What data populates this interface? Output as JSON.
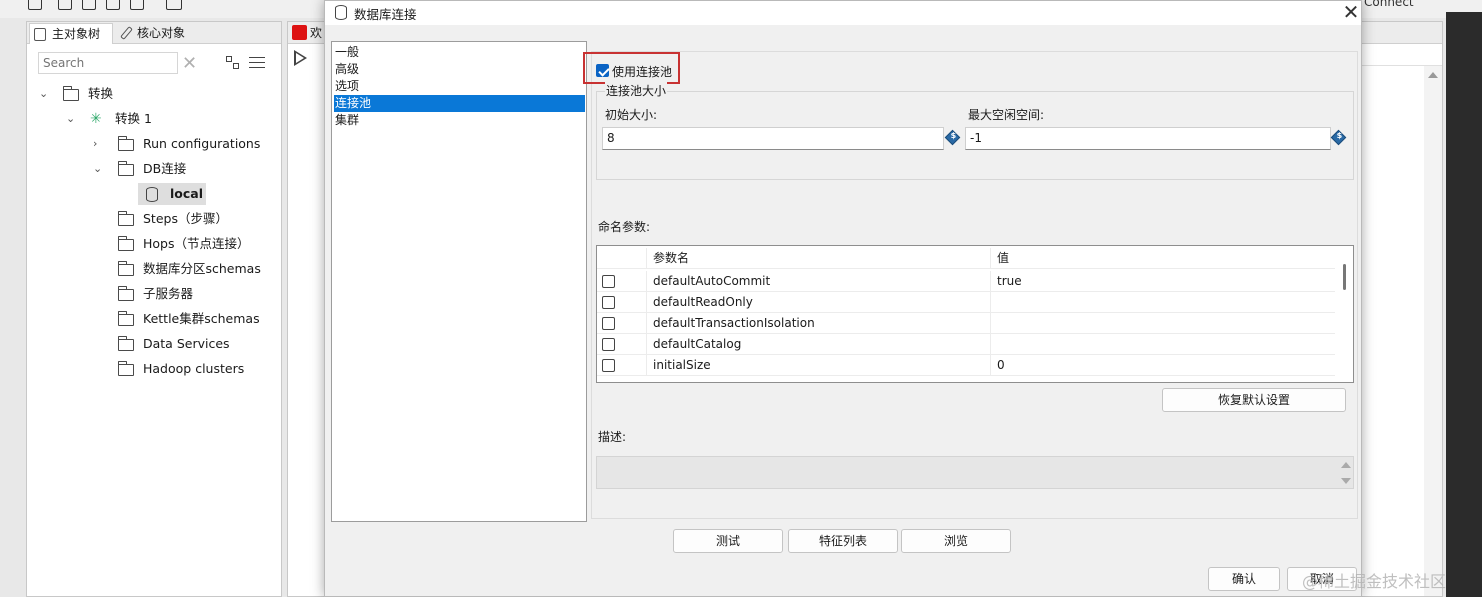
{
  "background_app": {
    "connect_label": "Connect",
    "left_panel": {
      "tabs": [
        {
          "label": "主对象树"
        },
        {
          "label": "核心对象"
        }
      ],
      "search_placeholder": "Search",
      "tree": {
        "root": "转换",
        "transformation": "转换 1",
        "items": {
          "run_configurations": "Run configurations",
          "db_connections": "DB连接",
          "local": "local",
          "steps": "Steps（步骤）",
          "hops": "Hops（节点连接）",
          "partition_schemas": "数据库分区schemas",
          "slave_servers": "子服务器",
          "cluster_schemas": "Kettle集群schemas",
          "data_services": "Data Services",
          "hadoop_clusters": "Hadoop clusters"
        }
      }
    },
    "center_tab_label": "欢"
  },
  "dialog": {
    "title": "数据库连接",
    "nav": [
      "一般",
      "高级",
      "选项",
      "连接池",
      "集群"
    ],
    "nav_selected_index": 3,
    "use_pool_label": "使用连接池",
    "use_pool_checked": true,
    "pool_size_group": "连接池大小",
    "initial_size_label": "初始大小:",
    "initial_size_value": "8",
    "max_idle_label": "最大空闲空间:",
    "max_idle_value": "-1",
    "named_params_label": "命名参数:",
    "params_table": {
      "col_name": "参数名",
      "col_value": "值",
      "rows": [
        {
          "name": "defaultAutoCommit",
          "value": "true"
        },
        {
          "name": "defaultReadOnly",
          "value": ""
        },
        {
          "name": "defaultTransactionIsolation",
          "value": ""
        },
        {
          "name": "defaultCatalog",
          "value": ""
        },
        {
          "name": "initialSize",
          "value": "0"
        }
      ]
    },
    "restore_defaults": "恢复默认设置",
    "description_label": "描述:",
    "buttons": {
      "test": "测试",
      "features": "特征列表",
      "browse": "浏览",
      "ok": "确认",
      "cancel": "取消"
    }
  },
  "watermark": "@稀土掘金技术社区",
  "colors": {
    "selection_blue": "#0a78d7",
    "highlight_red": "#c83232",
    "checkbox_blue": "#0a63c4",
    "transform_green": "#2ea86a"
  }
}
